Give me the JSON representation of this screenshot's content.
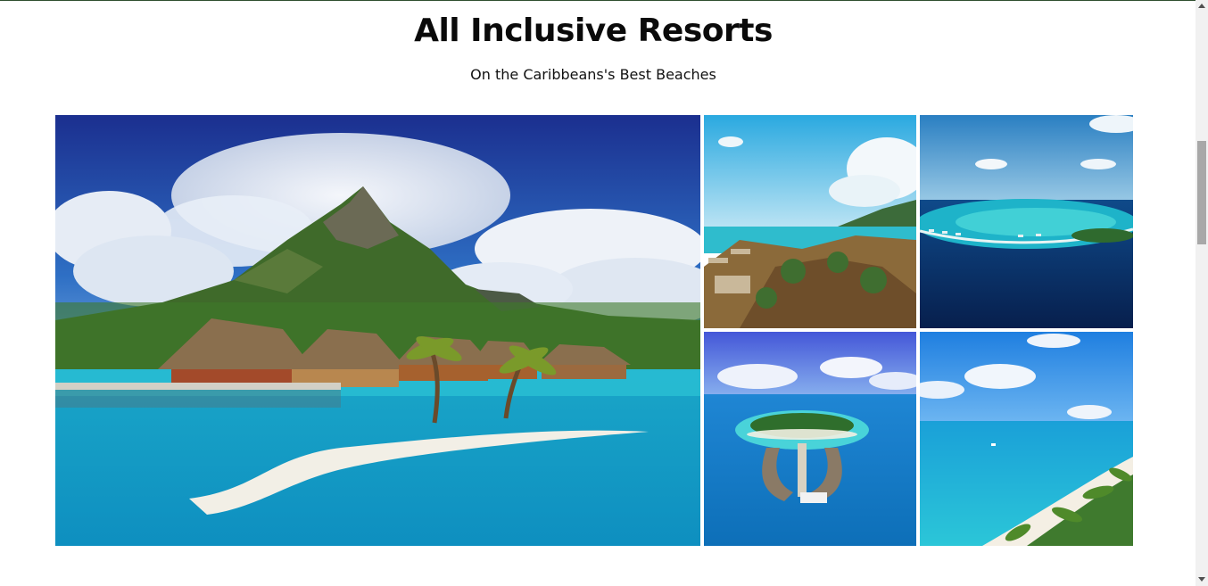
{
  "header": {
    "title": "All Inclusive Resorts",
    "subtitle": "On the Caribbeans's Best Beaches"
  },
  "gallery": {
    "images": [
      {
        "name": "overwater-bungalows-mountain-island"
      },
      {
        "name": "tropical-coast-overwater-villas"
      },
      {
        "name": "atoll-aerial-lagoon"
      },
      {
        "name": "round-island-resort-aerial"
      },
      {
        "name": "palm-beach-coastline-aerial"
      }
    ]
  },
  "colors": {
    "sky": "#1f4fa8",
    "lagoon": "#22b7d6",
    "deep_sea": "#0b2f66",
    "sand": "#f2efe6",
    "jungle": "#3f7d2a",
    "scrollbar_thumb": "#a8a8a8"
  }
}
